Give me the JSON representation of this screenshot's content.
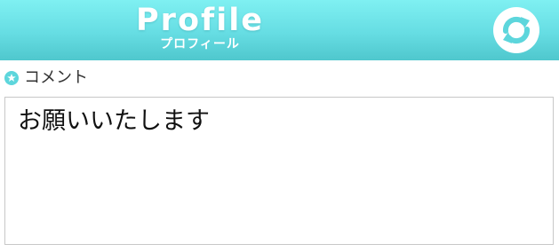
{
  "header": {
    "title": "Profile",
    "subtitle": "プロフィール",
    "refresh_icon": "refresh-icon",
    "gradient_colors": [
      "#7ff0f2",
      "#66dde3",
      "#4fc7cd"
    ]
  },
  "comment_section": {
    "label_icon": "star-icon",
    "label": "コメント",
    "text": "お願いいたします"
  },
  "colors": {
    "accent": "#5dd6dc",
    "border": "#c8c8c8",
    "text": "#111111"
  }
}
